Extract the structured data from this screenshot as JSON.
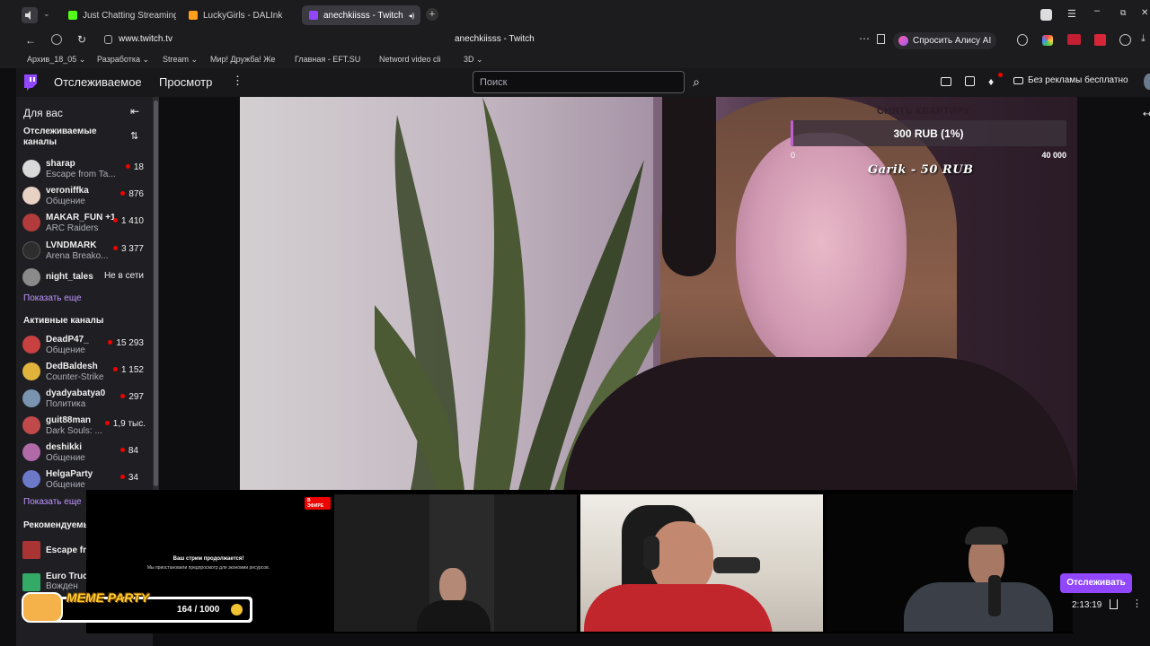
{
  "browser": {
    "tabs": [
      {
        "label": "Just Chatting Streaming - ",
        "favicon_color": "#53fc18"
      },
      {
        "label": "LuckyGirls - DALInk",
        "favicon_color": "#ff9f1a"
      },
      {
        "label": "anechkiisss - Twitch",
        "favicon_color": "#9147ff"
      }
    ],
    "url": "www.twitch.tv",
    "page_title": "anechkiisss - Twitch",
    "alice_label": "Спросить Алису AI",
    "bookmarks": [
      "Архив_18_05",
      "Разработка",
      "Stream",
      "Мир! Дружба! Же",
      "Главная - EFT.SU",
      "Netword video cli",
      "3D"
    ]
  },
  "nav": {
    "following": "Отслеживаемое",
    "browse": "Просмотр",
    "search_placeholder": "Поиск",
    "ad_free": "Без рекламы бесплатно"
  },
  "sidebar": {
    "title": "Для вас",
    "followed_heading": "Отслеживаемые каналы",
    "followed": [
      {
        "name": "sharap",
        "game": "Escape from Ta...",
        "viewers": "18",
        "avatar_color": "#d9d9d9"
      },
      {
        "name": "veroniffka",
        "game": "Общение",
        "viewers": "876",
        "avatar_color": "#e8d2c4"
      },
      {
        "name": "MAKAR_FUN +1",
        "game": "ARC Raiders",
        "viewers": "1 410",
        "avatar_color": "#b23b3b"
      },
      {
        "name": "LVNDMARK",
        "game": "Arena Breako...",
        "viewers": "3 377",
        "avatar_color": "#2d2d2d"
      },
      {
        "name": "night_tales",
        "game": "",
        "status": "Не в сети",
        "avatar_color": "#8a8a8a"
      }
    ],
    "show_more": "Показать еще",
    "active_heading": "Активные каналы",
    "active": [
      {
        "name": "DeadP47_",
        "game": "Общение",
        "viewers": "15 293",
        "avatar_color": "#c94040"
      },
      {
        "name": "DedBaldesh",
        "game": "Counter-Strike",
        "viewers": "1 152",
        "avatar_color": "#e0b33c"
      },
      {
        "name": "dyadyabatya0",
        "game": "Политика",
        "viewers": "297",
        "avatar_color": "#7a93b0"
      },
      {
        "name": "guit88man",
        "game": "Dark Souls: ...",
        "viewers": "1,9 тыс.",
        "avatar_color": "#c04a4a"
      },
      {
        "name": "deshikki",
        "game": "Общение",
        "viewers": "84",
        "avatar_color": "#b06aa8"
      },
      {
        "name": "HelgaParty",
        "game": "Общение",
        "viewers": "34",
        "avatar_color": "#6c79c9"
      }
    ],
    "show_more_2": "Показать еще",
    "recommended_heading": "Рекомендуемы",
    "recommended": [
      {
        "name": "Escape fr",
        "avatar_color": "#a33"
      },
      {
        "name": "Euro Truc",
        "game": "Вожден",
        "avatar_color": "#3a6"
      }
    ]
  },
  "stream_overlay": {
    "goal_title": "СНЯТЬ КВАРТИРУ",
    "goal_amount": "300 RUB (1%)",
    "goal_progress": 0.01,
    "goal_min": "0",
    "goal_max": "40 000",
    "donation": "Garik - 50 RUB"
  },
  "bottom": {
    "live_badge": "В ЭФИРЕ",
    "paused_title": "Ваш стрим продолжается!",
    "paused_text": "Мы приостановили предпросмотр для экономии ресурсов.",
    "meme_label": "MEME PARTY",
    "meme_count": "164 / 1000",
    "follow_label": "Отслеживать",
    "time": "2:13:19"
  }
}
